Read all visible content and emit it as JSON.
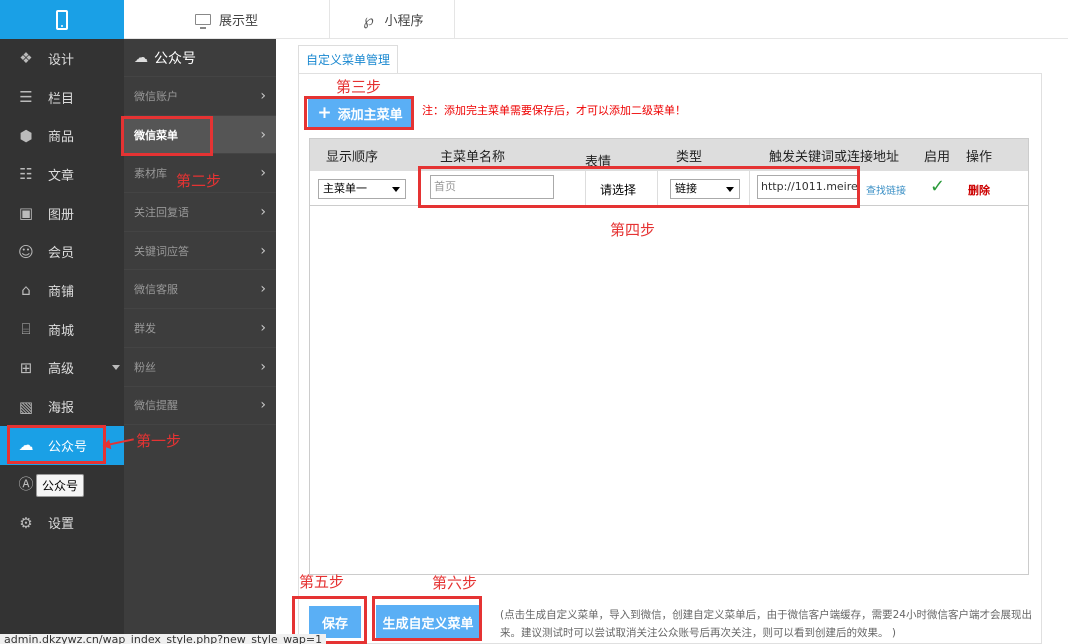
{
  "topbar": {
    "tabs": [
      {
        "label": "展示型",
        "icon": "monitor-icon"
      },
      {
        "label": "小程序",
        "icon": "mini-program-icon"
      }
    ]
  },
  "sidebar": {
    "items": [
      {
        "label": "设计",
        "icon": "design-icon"
      },
      {
        "label": "栏目",
        "icon": "list-icon"
      },
      {
        "label": "商品",
        "icon": "box-icon"
      },
      {
        "label": "文章",
        "icon": "article-icon"
      },
      {
        "label": "图册",
        "icon": "gallery-icon"
      },
      {
        "label": "会员",
        "icon": "user-icon"
      },
      {
        "label": "商铺",
        "icon": "shop-icon"
      },
      {
        "label": "商城",
        "icon": "mall-icon"
      },
      {
        "label": "高级",
        "icon": "grid-icon"
      },
      {
        "label": "海报",
        "icon": "poster-icon"
      },
      {
        "label": "公众号",
        "icon": "wechat-icon"
      },
      {
        "label": "",
        "icon": "app-icon"
      },
      {
        "label": "设置",
        "icon": "gear-icon"
      }
    ],
    "tooltip": "公众号"
  },
  "submenu": {
    "title": "公众号",
    "items": [
      "微信账户",
      "微信菜单",
      "素材库",
      "关注回复语",
      "关键词应答",
      "微信客服",
      "群发",
      "粉丝",
      "微信提醒"
    ]
  },
  "content": {
    "tab_title": "自定义菜单管理",
    "add_button": "添加主菜单",
    "note": "注：添加完主菜单需要保存后，才可以添加二级菜单！",
    "columns": [
      "显示顺序",
      "主菜单名称",
      "表情",
      "类型",
      "触发关键词或连接地址",
      "启用",
      "操作"
    ],
    "row": {
      "order": "主菜单一",
      "name_placeholder": "首页",
      "emoji": "请选择",
      "type": "链接",
      "url": "http://1011.meire",
      "find_link": "查找链接",
      "enabled": "✓",
      "delete": "删除"
    },
    "save_button": "保存",
    "generate_button": "生成自定义菜单",
    "bottom_note": "(点击生成自定义菜单，导入到微信，创建自定义菜单后，由于微信客户端缓存，需要24小时微信客户端才会展现出来。建议测试时可以尝试取消关注公众账号后再次关注，则可以看到创建后的效果。 )"
  },
  "annotations": {
    "step1": "第一步",
    "step2": "第二步",
    "step3": "第三步",
    "step4": "第四步",
    "step5": "第五步",
    "step6": "第六步"
  },
  "status_url": "admin.dkzywz.cn/wap_index_style.php?new_style_wap=1"
}
